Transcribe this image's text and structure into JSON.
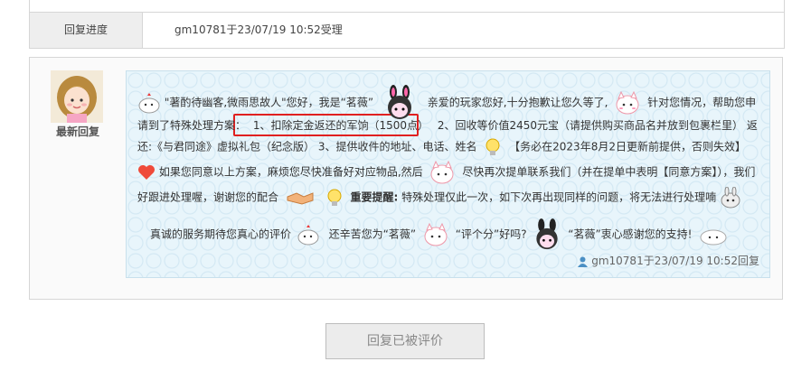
{
  "progress": {
    "label": "回复进度",
    "value": "gm10781于23/07/19 10:52受理"
  },
  "reply": {
    "avatar_label": "最新回复",
    "l1a": "\"著酌待幽客,微雨思故人\"您好，我是“茗薇”",
    "l1b": "亲爱的玩家您好,十分抱歉让您久等了,",
    "l1c": "针对您情况，帮助您申",
    "l2a": "请到了特殊处理方案：",
    "l2_highlight": "1、扣除定金返还的军饷（1500点）",
    "l2b": "2、回收等价值2450元宝（请提供购买商品名并放到包裹栏里） 返",
    "l3a": "还:《与君同途》虚拟礼包（纪念版） 3、提供收件的地址、电话、姓名",
    "l3b": "【务必在2023年8月2日更新前提供，否则失效】",
    "l4a": "如果您同意以上方案，麻烦您尽快准备好对应物品,然后",
    "l4b": "尽快再次提单联系我们（并在提单中表明【同意方案】），我们",
    "l5a": "好跟进处理喔，谢谢您的配合",
    "l5_bold": "重要提醒:",
    "l5b": "特殊处理仅此一次，如下次再出现同样的问题，将无法进行处理喃",
    "l6a": "真诚的服务期待您真心的评价",
    "l6b": "还辛苦您为“茗薇”",
    "l6c": "“评个分”好吗?",
    "l6d": "“茗薇”衷心感谢您的支持!",
    "signature": "gm10781于23/07/19 10:52回复"
  },
  "rated_button": "回复已被评价"
}
